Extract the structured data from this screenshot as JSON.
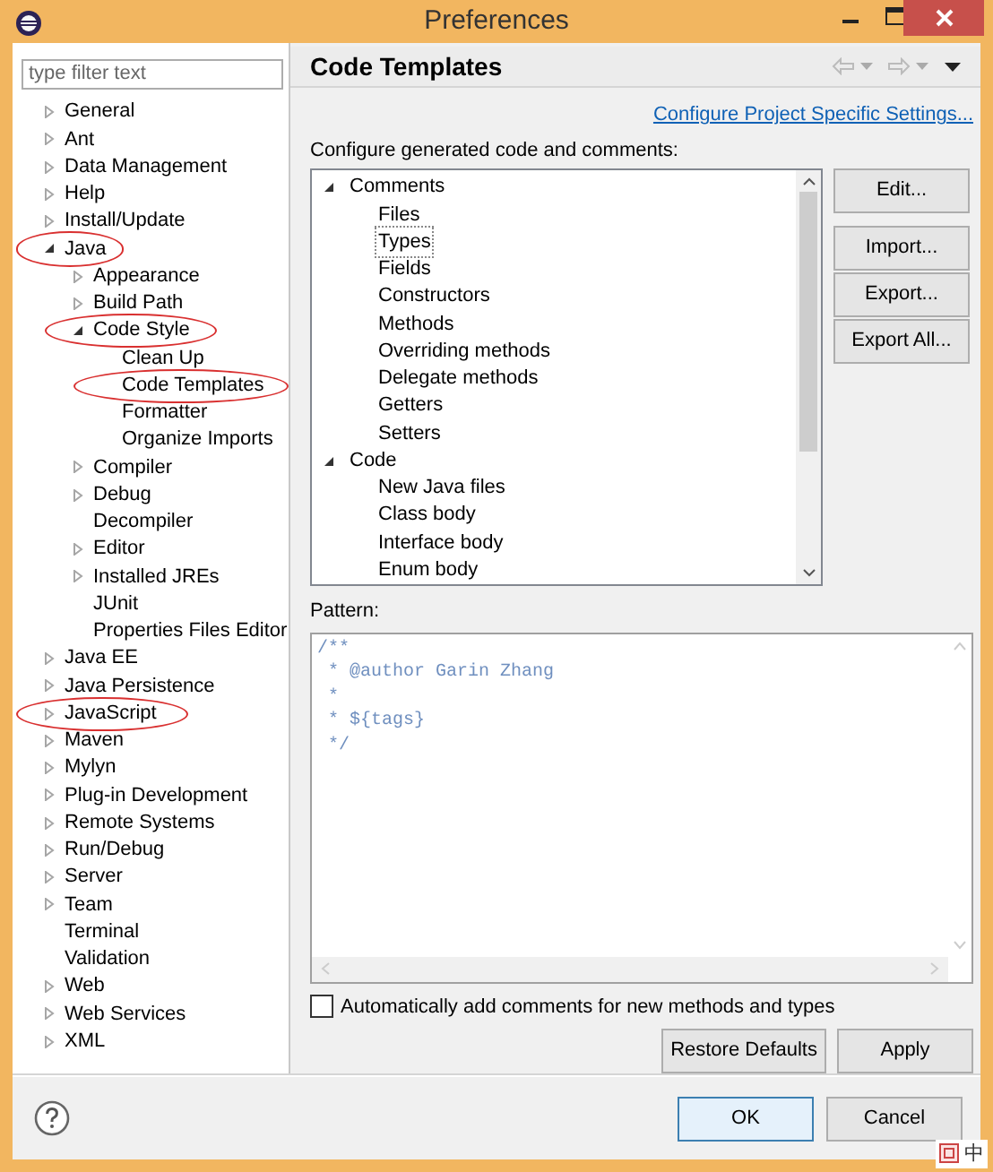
{
  "window": {
    "title": "Preferences"
  },
  "filter": {
    "placeholder": "type filter text"
  },
  "sidebar": {
    "items": [
      {
        "label": "General",
        "expandable": true,
        "expanded": false,
        "circled": false
      },
      {
        "label": "Ant",
        "expandable": true,
        "expanded": false,
        "circled": false
      },
      {
        "label": "Data Management",
        "expandable": true,
        "expanded": false,
        "circled": false
      },
      {
        "label": "Help",
        "expandable": true,
        "expanded": false,
        "circled": false
      },
      {
        "label": "Install/Update",
        "expandable": true,
        "expanded": false,
        "circled": false
      },
      {
        "label": "Java",
        "expandable": true,
        "expanded": true,
        "circled": true,
        "children": [
          {
            "label": "Appearance",
            "expandable": true,
            "expanded": false,
            "circled": false
          },
          {
            "label": "Build Path",
            "expandable": true,
            "expanded": false,
            "circled": false
          },
          {
            "label": "Code Style",
            "expandable": true,
            "expanded": true,
            "circled": true,
            "children": [
              {
                "label": "Clean Up",
                "expandable": false,
                "circled": false
              },
              {
                "label": "Code Templates",
                "expandable": false,
                "circled": true
              },
              {
                "label": "Formatter",
                "expandable": false,
                "circled": false
              },
              {
                "label": "Organize Imports",
                "expandable": false,
                "circled": false
              }
            ]
          },
          {
            "label": "Compiler",
            "expandable": true,
            "expanded": false,
            "circled": false
          },
          {
            "label": "Debug",
            "expandable": true,
            "expanded": false,
            "circled": false
          },
          {
            "label": "Decompiler",
            "expandable": false,
            "circled": false
          },
          {
            "label": "Editor",
            "expandable": true,
            "expanded": false,
            "circled": false
          },
          {
            "label": "Installed JREs",
            "expandable": true,
            "expanded": false,
            "circled": false
          },
          {
            "label": "JUnit",
            "expandable": false,
            "circled": false
          },
          {
            "label": "Properties Files Editor",
            "expandable": false,
            "circled": false
          }
        ]
      },
      {
        "label": "Java EE",
        "expandable": true,
        "expanded": false,
        "circled": false
      },
      {
        "label": "Java Persistence",
        "expandable": true,
        "expanded": false,
        "circled": false
      },
      {
        "label": "JavaScript",
        "expandable": true,
        "expanded": false,
        "circled": true
      },
      {
        "label": "Maven",
        "expandable": true,
        "expanded": false,
        "circled": false
      },
      {
        "label": "Mylyn",
        "expandable": true,
        "expanded": false,
        "circled": false
      },
      {
        "label": "Plug-in Development",
        "expandable": true,
        "expanded": false,
        "circled": false
      },
      {
        "label": "Remote Systems",
        "expandable": true,
        "expanded": false,
        "circled": false
      },
      {
        "label": "Run/Debug",
        "expandable": true,
        "expanded": false,
        "circled": false
      },
      {
        "label": "Server",
        "expandable": true,
        "expanded": false,
        "circled": false
      },
      {
        "label": "Team",
        "expandable": true,
        "expanded": false,
        "circled": false
      },
      {
        "label": "Terminal",
        "expandable": false,
        "circled": false
      },
      {
        "label": "Validation",
        "expandable": false,
        "circled": false
      },
      {
        "label": "Web",
        "expandable": true,
        "expanded": false,
        "circled": false
      },
      {
        "label": "Web Services",
        "expandable": true,
        "expanded": false,
        "circled": false
      },
      {
        "label": "XML",
        "expandable": true,
        "expanded": false,
        "circled": false
      }
    ]
  },
  "page": {
    "title": "Code Templates",
    "link": "Configure Project Specific Settings...",
    "list_label": "Configure generated code and comments:",
    "templates": [
      {
        "label": "Comments",
        "expanded": true,
        "children": [
          {
            "label": "Files",
            "selected": false
          },
          {
            "label": "Types",
            "selected": true
          },
          {
            "label": "Fields",
            "selected": false
          },
          {
            "label": "Constructors",
            "selected": false
          },
          {
            "label": "Methods",
            "selected": false
          },
          {
            "label": "Overriding methods",
            "selected": false
          },
          {
            "label": "Delegate methods",
            "selected": false
          },
          {
            "label": "Getters",
            "selected": false
          },
          {
            "label": "Setters",
            "selected": false
          }
        ]
      },
      {
        "label": "Code",
        "expanded": true,
        "children": [
          {
            "label": "New Java files",
            "selected": false
          },
          {
            "label": "Class body",
            "selected": false
          },
          {
            "label": "Interface body",
            "selected": false
          },
          {
            "label": "Enum body",
            "selected": false
          }
        ]
      }
    ],
    "side_buttons": [
      "Edit...",
      "Import...",
      "Export...",
      "Export All..."
    ],
    "pattern_label": "Pattern:",
    "pattern_lines": [
      "/**",
      " * @author Garin Zhang",
      " *",
      " * ${tags}",
      " */"
    ],
    "auto_comments": {
      "label": "Automatically add comments for new methods and types",
      "checked": false
    },
    "buttons": [
      "Restore Defaults",
      "Apply"
    ]
  },
  "footer": {
    "buttons": [
      "OK",
      "Cancel"
    ],
    "ime": "中"
  }
}
